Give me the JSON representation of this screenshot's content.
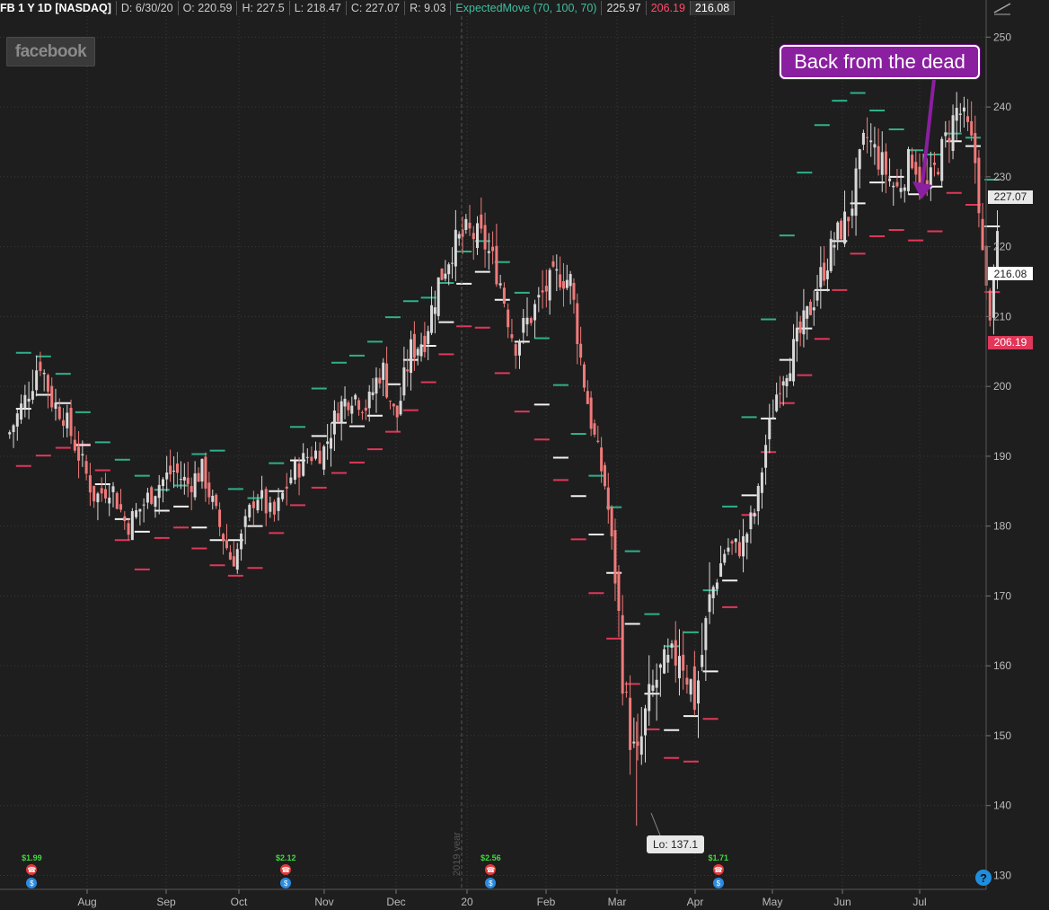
{
  "header": {
    "symbol": "FB 1 Y 1D [NASDAQ]",
    "date": "D: 6/30/20",
    "open": "O: 220.59",
    "high": "H: 227.5",
    "low": "L: 218.47",
    "close": "C: 227.07",
    "range": "R: 9.03",
    "study": "ExpectedMove (70, 100, 70)",
    "study_v1": "225.97",
    "study_v2": "206.19",
    "study_v3": "216.08"
  },
  "logo_text": "facebook",
  "annotation": "Back from the dead",
  "low_label": "Lo: 137.1",
  "year_label": "2019 year",
  "help_icon_text": "?",
  "price_tags": [
    {
      "text": "227.07",
      "value": 227.07,
      "bg": "#e8e8e8",
      "fg": "#222"
    },
    {
      "text": "216.08",
      "value": 216.08,
      "bg": "#ffffff",
      "fg": "#222"
    },
    {
      "text": "206.19",
      "value": 206.19,
      "bg": "#e0375a",
      "fg": "#fff"
    }
  ],
  "dividends": [
    {
      "label": "$1.99",
      "month_index": 0.3
    },
    {
      "label": "$2.12",
      "month_index": 3.55
    },
    {
      "label": "$2.56",
      "month_index": 6.3
    },
    {
      "label": "$1.71",
      "month_index": 9.3
    }
  ],
  "colors": {
    "background": "#1e1e1e",
    "up": "#d9d9d9",
    "down": "#f07a7a",
    "em_upper": "#2fb08a",
    "em_lower": "#e0375a",
    "em_mid": "#f2f2f2",
    "grid": "#3a3a3a",
    "annotation": "#8a1fa0"
  },
  "chart_data": {
    "type": "candlestick",
    "title": "FB 1 Y 1D [NASDAQ]",
    "xlabel": "",
    "ylabel": "",
    "y_ticks": [
      130,
      140,
      150,
      160,
      170,
      180,
      190,
      200,
      210,
      220,
      230,
      240,
      250
    ],
    "ylim": [
      128,
      253
    ],
    "x_ticks": [
      "Aug",
      "Sep",
      "Oct",
      "Nov",
      "Dec",
      "20",
      "Feb",
      "Mar",
      "Apr",
      "May",
      "Jun",
      "Jul"
    ],
    "grid": true,
    "close_path": [
      [
        0,
        193
      ],
      [
        0.25,
        199
      ],
      [
        0.4,
        204
      ],
      [
        0.55,
        198
      ],
      [
        0.7,
        196
      ],
      [
        0.9,
        190
      ],
      [
        1.1,
        184
      ],
      [
        1.3,
        186
      ],
      [
        1.5,
        180
      ],
      [
        1.7,
        183
      ],
      [
        1.9,
        186
      ],
      [
        2.1,
        188
      ],
      [
        2.3,
        186
      ],
      [
        2.5,
        188
      ],
      [
        2.7,
        181
      ],
      [
        2.9,
        175
      ],
      [
        3.0,
        177
      ],
      [
        3.2,
        185
      ],
      [
        3.4,
        181
      ],
      [
        3.6,
        187
      ],
      [
        3.8,
        190
      ],
      [
        4.0,
        191
      ],
      [
        4.2,
        197
      ],
      [
        4.4,
        199
      ],
      [
        4.6,
        197
      ],
      [
        4.8,
        203
      ],
      [
        5.0,
        195
      ],
      [
        5.2,
        205
      ],
      [
        5.4,
        207
      ],
      [
        5.6,
        215
      ],
      [
        5.8,
        220
      ],
      [
        6.0,
        222
      ],
      [
        6.2,
        221
      ],
      [
        6.4,
        216
      ],
      [
        6.6,
        206
      ],
      [
        6.8,
        210
      ],
      [
        7.0,
        214
      ],
      [
        7.2,
        216
      ],
      [
        7.35,
        215
      ],
      [
        7.5,
        203
      ],
      [
        7.65,
        194
      ],
      [
        7.85,
        185
      ],
      [
        8.0,
        170
      ],
      [
        8.1,
        155
      ],
      [
        8.25,
        145
      ],
      [
        8.35,
        152
      ],
      [
        8.5,
        158
      ],
      [
        8.7,
        160
      ],
      [
        8.8,
        163
      ],
      [
        9.0,
        155
      ],
      [
        9.2,
        170
      ],
      [
        9.4,
        177
      ],
      [
        9.6,
        177
      ],
      [
        9.8,
        183
      ],
      [
        9.9,
        191
      ],
      [
        10.1,
        201
      ],
      [
        10.3,
        205
      ],
      [
        10.5,
        210
      ],
      [
        10.7,
        216
      ],
      [
        10.9,
        221
      ],
      [
        11.1,
        225
      ],
      [
        11.3,
        236
      ],
      [
        11.5,
        232
      ],
      [
        11.7,
        228
      ],
      [
        11.9,
        233
      ],
      [
        12.1,
        228
      ],
      [
        12.3,
        234
      ],
      [
        12.5,
        240
      ],
      [
        12.65,
        236
      ],
      [
        12.75,
        231
      ],
      [
        12.85,
        214
      ],
      [
        12.95,
        210
      ],
      [
        13.05,
        227
      ]
    ],
    "expected_move": {
      "upper": [
        [
          0,
          205
        ],
        [
          0.5,
          204
        ],
        [
          1.0,
          193
        ],
        [
          1.5,
          188
        ],
        [
          2.0,
          184
        ],
        [
          2.5,
          193
        ],
        [
          3.0,
          182
        ],
        [
          3.5,
          192
        ],
        [
          4.0,
          203
        ],
        [
          4.5,
          205
        ],
        [
          5.0,
          212
        ],
        [
          5.5,
          213
        ],
        [
          6.0,
          222
        ],
        [
          6.5,
          216
        ],
        [
          7.0,
          203
        ],
        [
          7.5,
          189
        ],
        [
          8.0,
          180
        ],
        [
          8.5,
          162
        ],
        [
          9.0,
          166
        ],
        [
          9.5,
          190
        ],
        [
          10.0,
          218
        ],
        [
          10.5,
          236
        ],
        [
          11.0,
          243
        ],
        [
          11.5,
          238
        ],
        [
          12.0,
          232
        ],
        [
          12.5,
          238
        ],
        [
          13.0,
          226
        ]
      ],
      "lower": [
        [
          0,
          188
        ],
        [
          0.5,
          191
        ],
        [
          1.0,
          192
        ],
        [
          1.5,
          172
        ],
        [
          2.0,
          181
        ],
        [
          2.5,
          175
        ],
        [
          3.0,
          172
        ],
        [
          3.5,
          182
        ],
        [
          4.0,
          187
        ],
        [
          4.5,
          190
        ],
        [
          5.0,
          195
        ],
        [
          5.5,
          203
        ],
        [
          6.0,
          211
        ],
        [
          6.5,
          198
        ],
        [
          7.0,
          190
        ],
        [
          7.5,
          173
        ],
        [
          8.0,
          160
        ],
        [
          8.5,
          147
        ],
        [
          9.0,
          146
        ],
        [
          9.5,
          178
        ],
        [
          10.0,
          196
        ],
        [
          10.5,
          204
        ],
        [
          11.0,
          218
        ],
        [
          11.5,
          223
        ],
        [
          12.0,
          220
        ],
        [
          12.5,
          231
        ],
        [
          13.0,
          206
        ]
      ],
      "mid": [
        [
          0,
          196
        ],
        [
          0.5,
          200
        ],
        [
          1.0,
          188
        ],
        [
          1.5,
          178
        ],
        [
          2.0,
          184
        ],
        [
          2.5,
          178
        ],
        [
          3.0,
          178
        ],
        [
          3.5,
          188
        ],
        [
          4.0,
          195
        ],
        [
          4.5,
          194
        ],
        [
          5.0,
          203
        ],
        [
          5.5,
          207
        ],
        [
          6.0,
          218
        ],
        [
          6.5,
          210
        ],
        [
          7.0,
          192
        ],
        [
          7.5,
          181
        ],
        [
          8.0,
          170
        ],
        [
          8.5,
          150
        ],
        [
          9.0,
          154
        ],
        [
          9.5,
          180
        ],
        [
          10.0,
          202
        ],
        [
          10.5,
          211
        ],
        [
          11.0,
          225
        ],
        [
          11.5,
          231
        ],
        [
          12.0,
          226
        ],
        [
          12.5,
          239
        ],
        [
          13.0,
          216
        ]
      ]
    },
    "low_point": {
      "month_index": 8.25,
      "value": 137.1
    }
  }
}
